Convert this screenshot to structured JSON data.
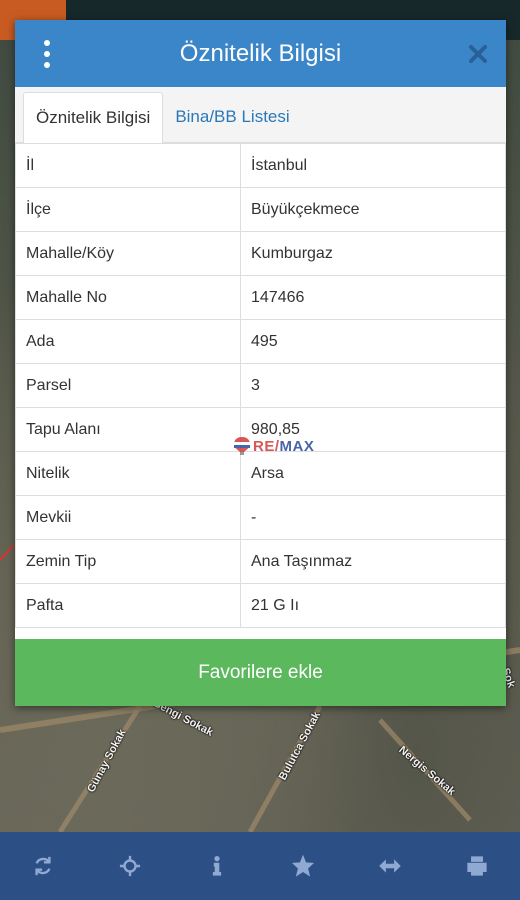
{
  "modal": {
    "title": "Öznitelik Bilgisi",
    "tabs": [
      {
        "label": "Öznitelik Bilgisi",
        "active": true
      },
      {
        "label": "Bina/BB Listesi",
        "active": false
      }
    ],
    "attributes": [
      {
        "key": "İl",
        "value": "İstanbul"
      },
      {
        "key": "İlçe",
        "value": "Büyükçekmece"
      },
      {
        "key": "Mahalle/Köy",
        "value": "Kumburgaz"
      },
      {
        "key": "Mahalle No",
        "value": "147466"
      },
      {
        "key": "Ada",
        "value": "495"
      },
      {
        "key": "Parsel",
        "value": "3"
      },
      {
        "key": "Tapu Alanı",
        "value": "980,85"
      },
      {
        "key": "Nitelik",
        "value": "Arsa"
      },
      {
        "key": "Mevkii",
        "value": "-"
      },
      {
        "key": "Zemin Tip",
        "value": "Ana Taşınmaz"
      },
      {
        "key": "Pafta",
        "value": "21 G Iı"
      }
    ],
    "favorite_button": "Favorilere ekle"
  },
  "watermark": {
    "re": "RE/",
    "max": "MAX"
  },
  "map": {
    "streets": [
      "Bengi Sokak",
      "Bulutca Sokak",
      "Nergis Sokak",
      "Günay Sokak",
      "Sok"
    ]
  },
  "toolbar": {
    "icons": [
      "refresh-icon",
      "locate-icon",
      "info-icon",
      "star-icon",
      "measure-icon",
      "print-icon"
    ]
  },
  "colors": {
    "header": "#3a86c8",
    "favorite_button": "#5cb85c",
    "toolbar": "#2c4f86",
    "tab_link": "#2b78b8"
  }
}
